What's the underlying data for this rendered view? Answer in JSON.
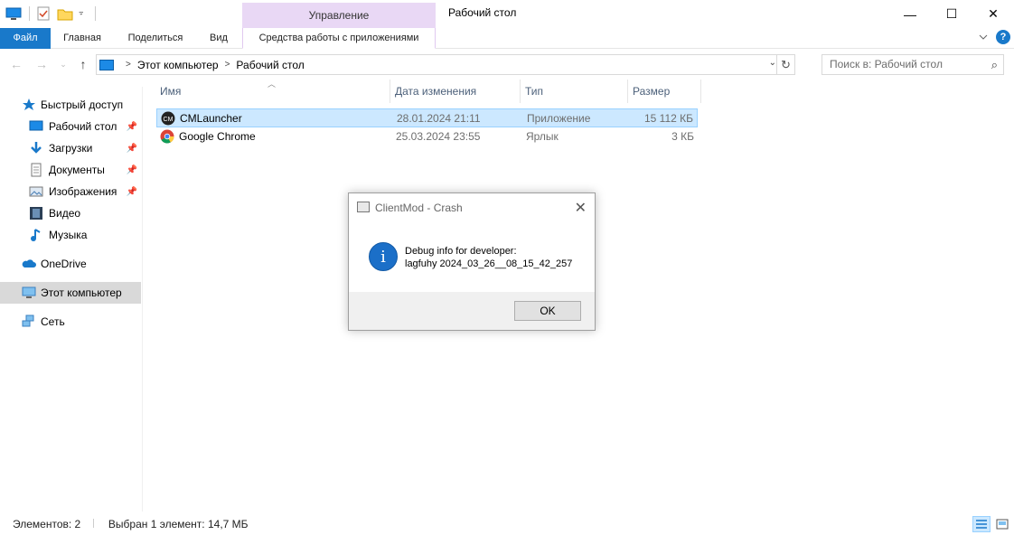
{
  "window": {
    "title": "Рабочий стол",
    "manage_label": "Управление",
    "minimize": "—",
    "maximize": "☐",
    "close": "✕"
  },
  "ribbon": {
    "tabs": [
      "Файл",
      "Главная",
      "Поделиться",
      "Вид"
    ],
    "tools_tab": "Средства работы с приложениями",
    "help": "?"
  },
  "address": {
    "breadcrumbs": [
      "Этот компьютер",
      "Рабочий стол"
    ],
    "search_placeholder": "Поиск в: Рабочий стол"
  },
  "sidebar": {
    "items": [
      {
        "label": "Быстрый доступ",
        "icon": "star-icon",
        "pinned": false
      },
      {
        "label": "Рабочий стол",
        "icon": "desktop-icon",
        "pinned": true
      },
      {
        "label": "Загрузки",
        "icon": "download-icon",
        "pinned": true
      },
      {
        "label": "Документы",
        "icon": "document-icon",
        "pinned": true
      },
      {
        "label": "Изображения",
        "icon": "image-icon",
        "pinned": true
      },
      {
        "label": "Видео",
        "icon": "video-icon",
        "pinned": false
      },
      {
        "label": "Музыка",
        "icon": "music-icon",
        "pinned": false
      },
      {
        "label": "OneDrive",
        "icon": "cloud-icon",
        "pinned": false
      },
      {
        "label": "Этот компьютер",
        "icon": "computer-icon",
        "pinned": false
      },
      {
        "label": "Сеть",
        "icon": "network-icon",
        "pinned": false
      }
    ]
  },
  "file_list": {
    "columns": [
      "Имя",
      "Дата изменения",
      "Тип",
      "Размер"
    ],
    "rows": [
      {
        "name": "CMLauncher",
        "date": "28.01.2024 21:11",
        "type": "Приложение",
        "size": "15 112 КБ",
        "selected": true
      },
      {
        "name": "Google Chrome",
        "date": "25.03.2024 23:55",
        "type": "Ярлык",
        "size": "3 КБ",
        "selected": false
      }
    ]
  },
  "status": {
    "count": "Элементов: 2",
    "selection": "Выбран 1 элемент: 14,7 МБ"
  },
  "dialog": {
    "title": "ClientMod - Crash",
    "line1": "Debug info for developer:",
    "line2": "lagfuhy 2024_03_26__08_15_42_257",
    "ok": "OK"
  },
  "colors": {
    "accent": "#1979ca",
    "selection": "#cce8ff",
    "manage_tab": "#e9d8f5"
  }
}
